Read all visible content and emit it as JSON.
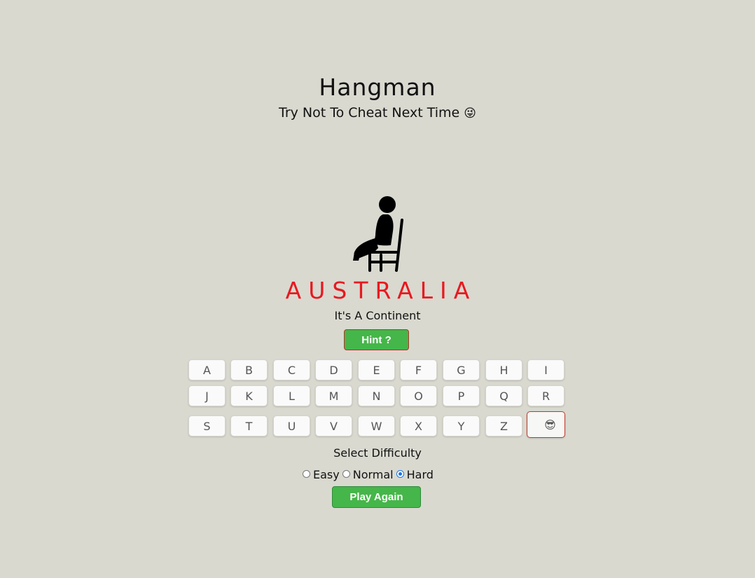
{
  "header": {
    "title": "Hangman",
    "subtitle": "Try Not To Cheat Next Time",
    "subtitle_emoji": "😜"
  },
  "game": {
    "answer": "AUSTRALIA",
    "category": "It's A Continent",
    "hint_label": "Hint ?"
  },
  "keyboard": {
    "row1": [
      "A",
      "B",
      "C",
      "D",
      "E",
      "F",
      "G",
      "H",
      "I"
    ],
    "row2": [
      "J",
      "K",
      "L",
      "M",
      "N",
      "O",
      "P",
      "Q",
      "R"
    ],
    "row3": [
      "S",
      "T",
      "U",
      "V",
      "W",
      "X",
      "Y",
      "Z"
    ],
    "special_key": "😎"
  },
  "difficulty": {
    "label": "Select Difficulty",
    "options": [
      "Easy",
      "Normal",
      "Hard"
    ],
    "selected": "Hard"
  },
  "actions": {
    "play_again_label": "Play Again"
  },
  "colors": {
    "background": "#d9d9d0",
    "answer": "#e8191f",
    "button_green": "#45b649"
  }
}
